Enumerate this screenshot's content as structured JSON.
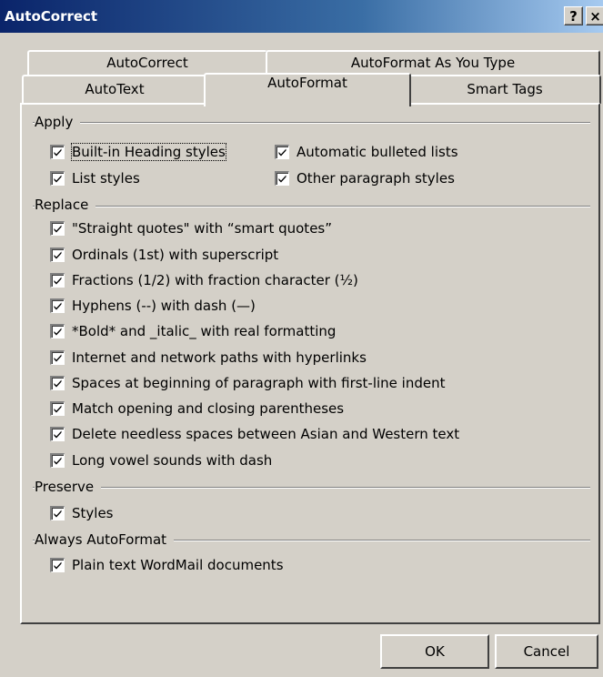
{
  "window": {
    "title": "AutoCorrect",
    "help_label": "?",
    "close_label": "×"
  },
  "tabs": {
    "row1": [
      {
        "label": "AutoCorrect"
      },
      {
        "label": "AutoFormat As You Type"
      }
    ],
    "row2": [
      {
        "label": "AutoText"
      },
      {
        "label": "AutoFormat",
        "active": true
      },
      {
        "label": "Smart Tags"
      }
    ]
  },
  "groups": {
    "apply": {
      "label": "Apply",
      "items": [
        {
          "label": "Built-in Heading styles",
          "checked": true
        },
        {
          "label": "Automatic bulleted lists",
          "checked": true
        },
        {
          "label": "List styles",
          "checked": true
        },
        {
          "label": "Other paragraph styles",
          "checked": true
        }
      ]
    },
    "replace": {
      "label": "Replace",
      "items": [
        {
          "label": "\"Straight quotes\" with “smart quotes”",
          "checked": true
        },
        {
          "label": "Ordinals (1st) with superscript",
          "checked": true
        },
        {
          "label": "Fractions (1/2) with fraction character (½)",
          "checked": true
        },
        {
          "label": "Hyphens (--) with dash (—)",
          "checked": true
        },
        {
          "label": "*Bold* and _italic_ with real formatting",
          "checked": true
        },
        {
          "label": "Internet and network paths with hyperlinks",
          "checked": true
        },
        {
          "label": "Spaces at beginning of paragraph with first-line indent",
          "checked": true
        },
        {
          "label": "Match opening and closing parentheses",
          "checked": true
        },
        {
          "label": "Delete needless spaces between Asian and Western text",
          "checked": true
        },
        {
          "label": "Long vowel sounds with dash",
          "checked": true
        }
      ]
    },
    "preserve": {
      "label": "Preserve",
      "items": [
        {
          "label": "Styles",
          "checked": true
        }
      ]
    },
    "always": {
      "label": "Always AutoFormat",
      "items": [
        {
          "label": "Plain text WordMail documents",
          "checked": true
        }
      ]
    }
  },
  "buttons": {
    "ok": "OK",
    "cancel": "Cancel"
  }
}
